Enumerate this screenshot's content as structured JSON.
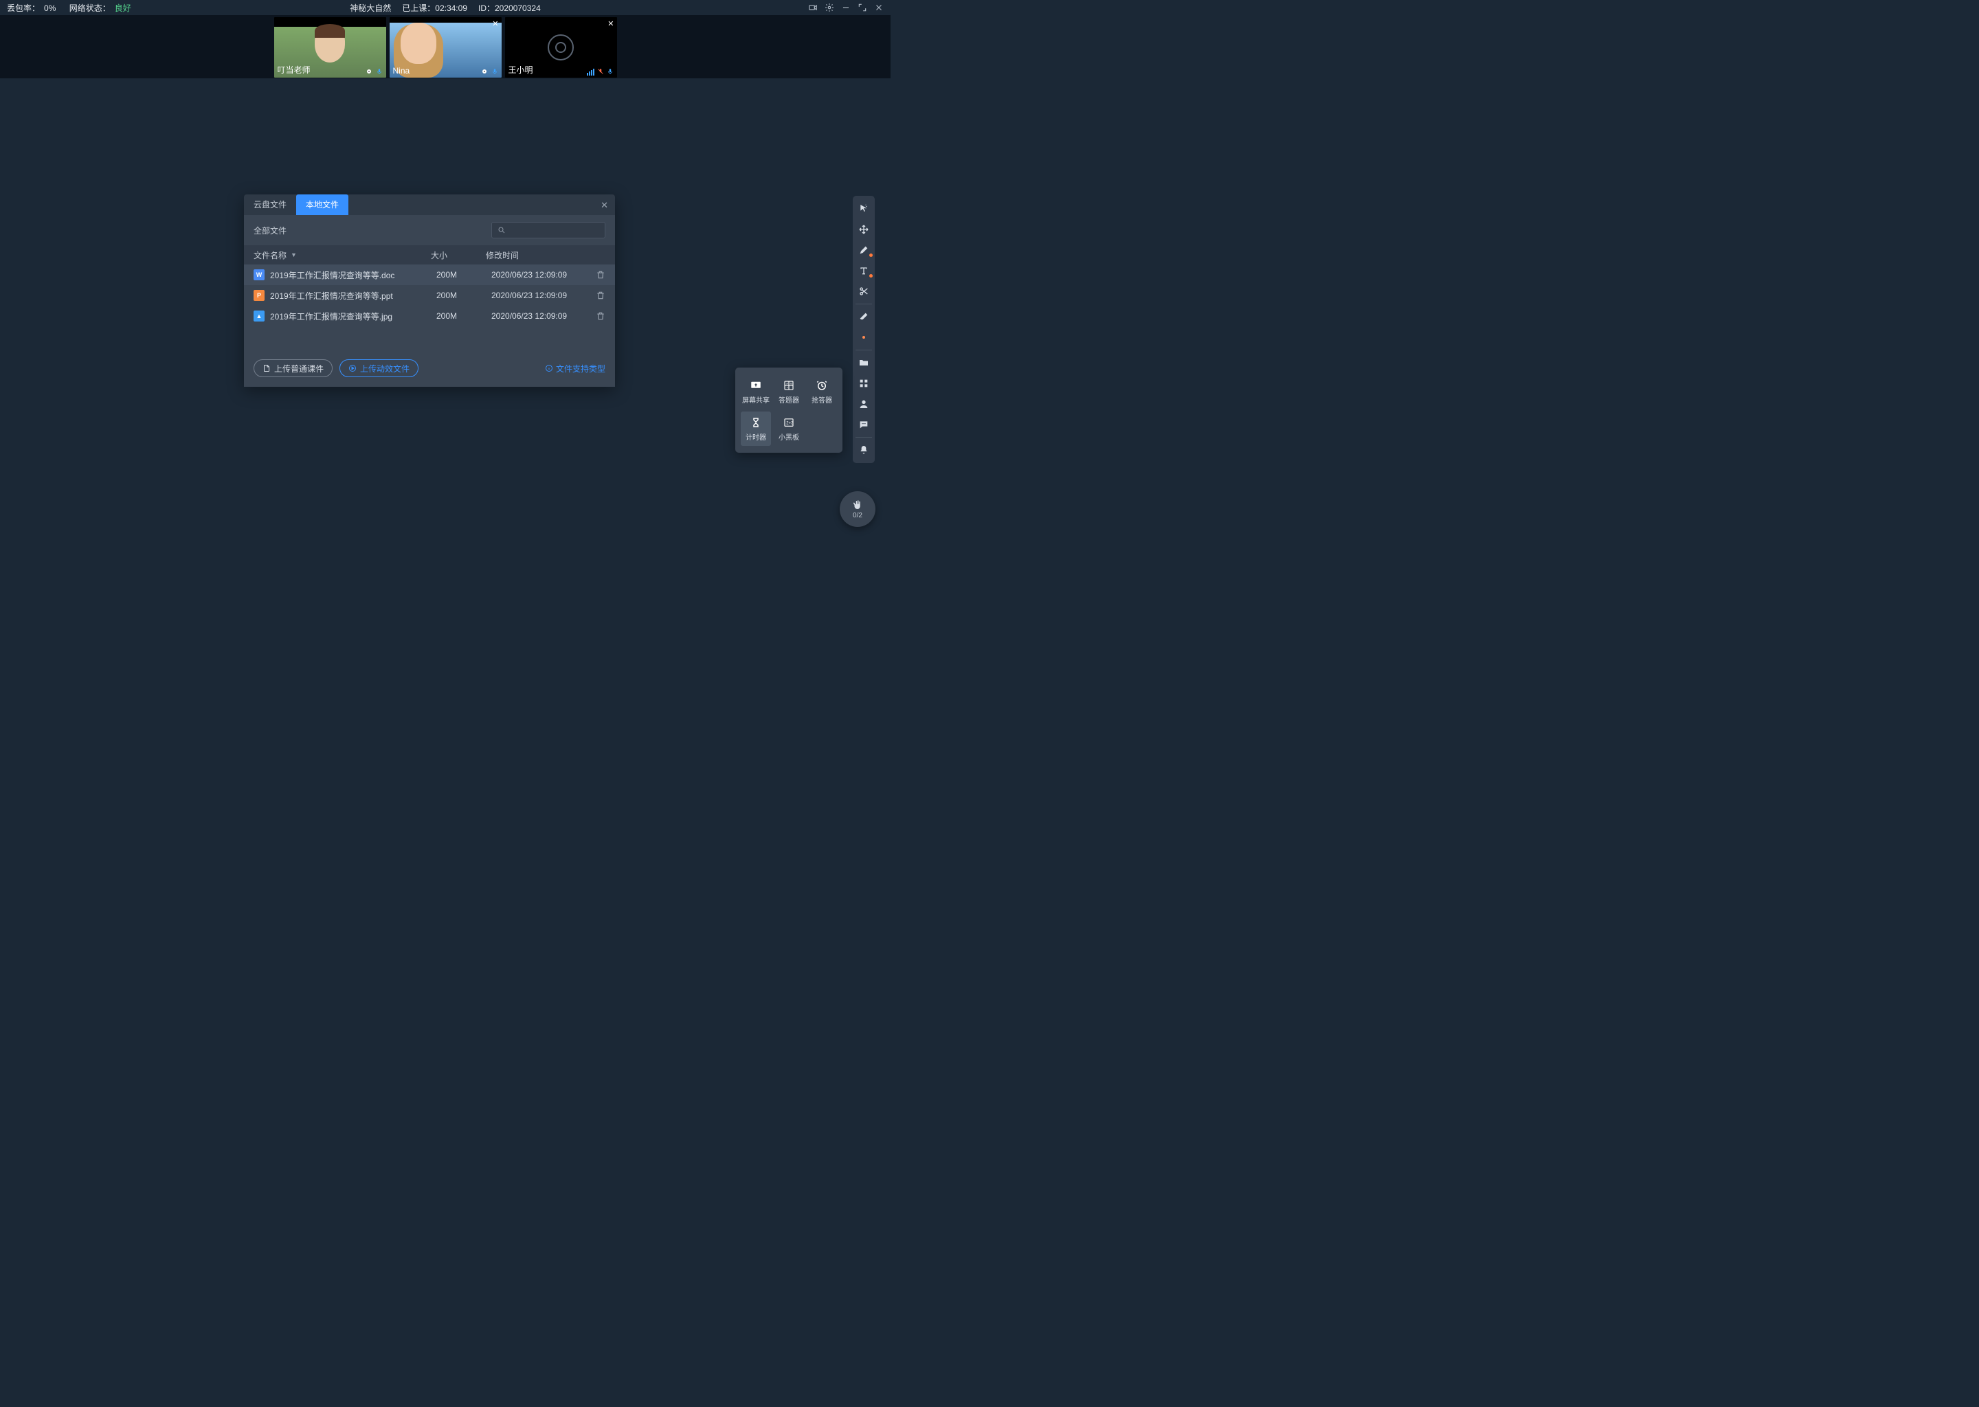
{
  "header": {
    "packet_loss_label": "丢包率：",
    "packet_loss_value": "0%",
    "net_label": "网络状态：",
    "net_value": "良好",
    "title": "神秘大自然",
    "elapsed_label": "已上课：",
    "elapsed_value": "02:34:09",
    "id_label": "ID：",
    "id_value": "2020070324"
  },
  "participants": [
    {
      "name": "叮当老师"
    },
    {
      "name": "Nina"
    },
    {
      "name": "王小明"
    }
  ],
  "dialog": {
    "tab_cloud": "云盘文件",
    "tab_local": "本地文件",
    "all_files": "全部文件",
    "col_name": "文件名称",
    "col_size": "大小",
    "col_time": "修改时间",
    "rows": [
      {
        "name": "2019年工作汇报情况查询等等.doc",
        "size": "200M",
        "time": "2020/06/23 12:09:09",
        "kind": "W"
      },
      {
        "name": "2019年工作汇报情况查询等等.ppt",
        "size": "200M",
        "time": "2020/06/23 12:09:09",
        "kind": "P"
      },
      {
        "name": "2019年工作汇报情况查询等等.jpg",
        "size": "200M",
        "time": "2020/06/23 12:09:09",
        "kind": "▲"
      }
    ],
    "btn_upload": "上传普通课件",
    "btn_upload_anim": "上传动效文件",
    "support_types": "文件支持类型"
  },
  "tool_panel": {
    "items": [
      {
        "label": "屏幕共享"
      },
      {
        "label": "答题器"
      },
      {
        "label": "抢答器"
      },
      {
        "label": "计时器"
      },
      {
        "label": "小黑板"
      }
    ]
  },
  "raise_hand": {
    "count": "0/2"
  }
}
